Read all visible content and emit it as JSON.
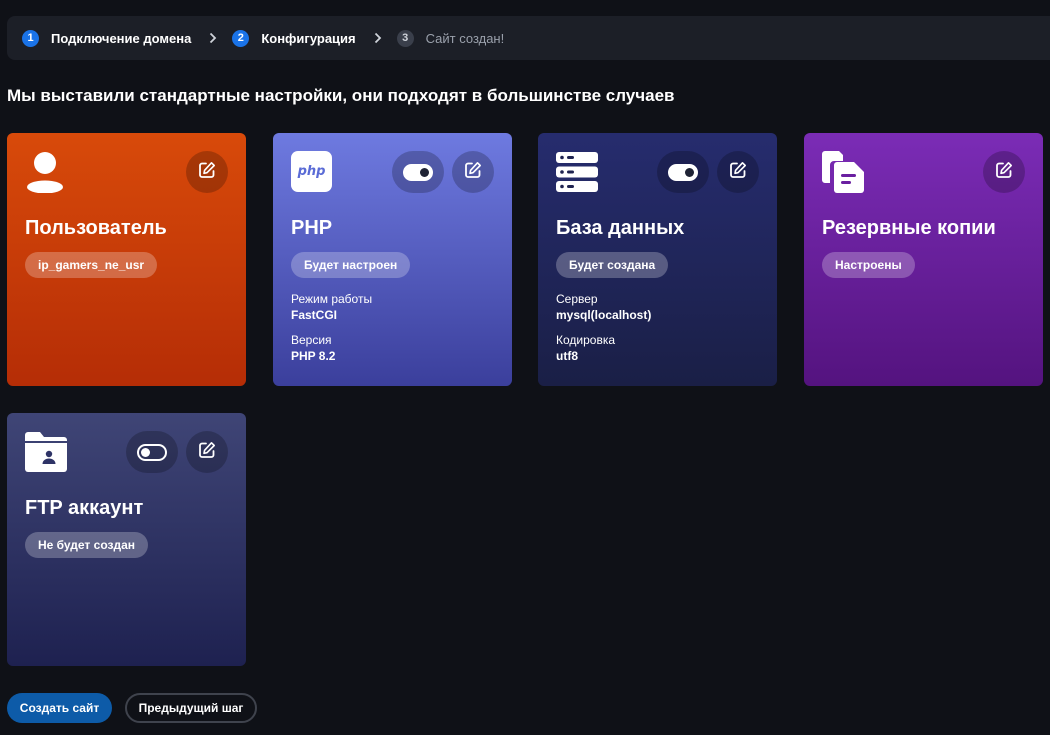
{
  "stepper": {
    "steps": [
      {
        "num": "1",
        "label": "Подключение домена"
      },
      {
        "num": "2",
        "label": "Конфигурация"
      },
      {
        "num": "3",
        "label": "Сайт создан!"
      }
    ]
  },
  "heading": "Мы выставили стандартные настройки, они подходят в большинстве случаев",
  "cards": {
    "user": {
      "title": "Пользователь",
      "badge": "ip_gamers_ne_usr",
      "logo_icon": "user-icon",
      "color": "#d84a0a"
    },
    "php": {
      "title": "PHP",
      "badge": "Будет настроен",
      "logo_text": "php",
      "toggle": "on",
      "props": [
        {
          "label": "Режим работы",
          "value": "FastCGI"
        },
        {
          "label": "Версия",
          "value": "PHP 8.2"
        }
      ],
      "color": "#6e7ae0"
    },
    "db": {
      "title": "База данных",
      "badge": "Будет создана",
      "logo_icon": "database-icon",
      "toggle": "on",
      "props": [
        {
          "label": "Сервер",
          "value": "mysql(localhost)"
        },
        {
          "label": "Кодировка",
          "value": "utf8"
        }
      ],
      "color": "#262c6e"
    },
    "backup": {
      "title": "Резервные копии",
      "badge": "Настроены",
      "logo_icon": "backup-copies-icon",
      "color": "#7b2cb6"
    },
    "ftp": {
      "title": "FTP аккаунт",
      "badge": "Не будет создан",
      "logo_icon": "ftp-folder-icon",
      "toggle": "off",
      "color": "#3f4576"
    }
  },
  "buttons": {
    "create": "Создать сайт",
    "prev": "Предыдущий шаг"
  }
}
